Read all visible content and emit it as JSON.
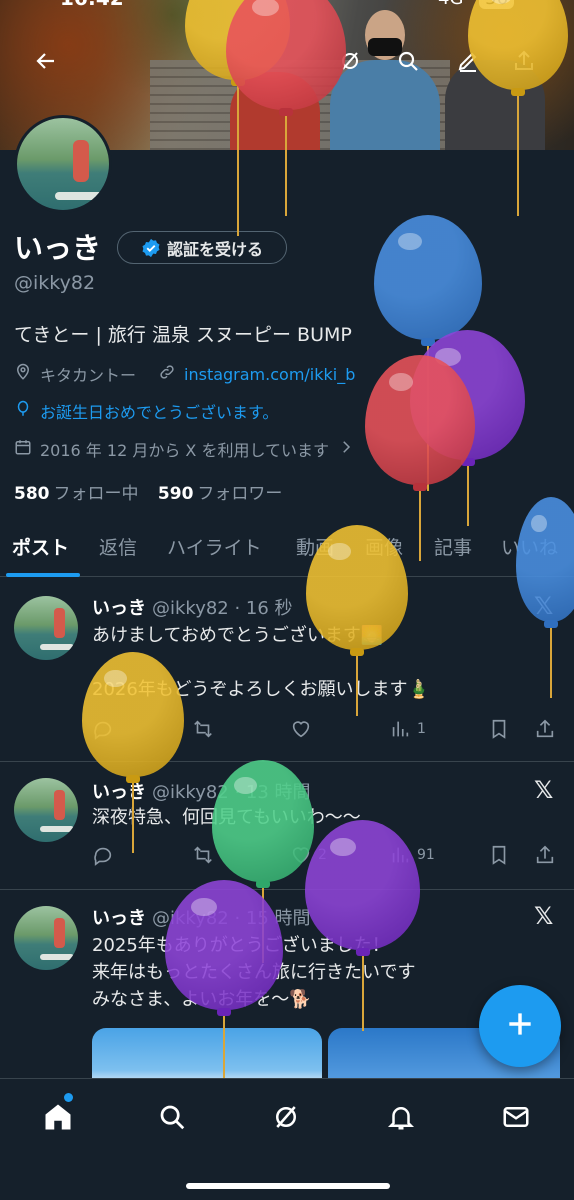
{
  "status_bar": {
    "time": "16:42",
    "signal": "4G",
    "battery": "56"
  },
  "top_bar": {
    "icons": [
      "back-arrow-icon",
      "grok-icon",
      "search-icon",
      "compose-icon",
      "share-icon"
    ]
  },
  "profile": {
    "name": "いっき",
    "verify_button": "認証を受ける",
    "handle": "@ikky82",
    "bio": "てきとー | 旅行 温泉 スヌーピー BUMP",
    "location": "キタカントー",
    "link": "instagram.com/ikki_b",
    "birthday": "お誕生日おめでとうございます。",
    "joined": "2016 年 12 月から X を利用しています",
    "following_count": "580",
    "following_label": "フォロー中",
    "followers_count": "590",
    "followers_label": "フォロワー"
  },
  "tabs": [
    "ポスト",
    "返信",
    "ハイライト",
    "動画",
    "画像",
    "記事",
    "いいね"
  ],
  "posts": [
    {
      "name": "いっき",
      "meta": "@ikky82 · 16 秒",
      "text": "あけましておめでとうございます🌅\n\n2026年もどうぞよろしくお願いします🎍",
      "retweets": "",
      "likes": "",
      "views": "1"
    },
    {
      "name": "いっき",
      "meta": "@ikky82 · 13 時間",
      "text": "深夜特急、何回見てもいいわ〜〜",
      "retweets": "",
      "likes": "2",
      "views": "91"
    },
    {
      "name": "いっき",
      "meta": "@ikky82 · 15 時間",
      "text": "2025年もありがとうございました！\n来年はもっとたくさん旅に行きたいです\nみなさま、よいお年を〜🐕",
      "retweets": "",
      "likes": "",
      "views": ""
    }
  ],
  "fab": {
    "icon": "plus-icon"
  },
  "bottom_nav": [
    "home-icon",
    "search-icon",
    "grok-icon",
    "notifications-icon",
    "messages-icon"
  ],
  "colors": {
    "background": "#15202b",
    "accent": "#1d9bf0",
    "secondary_text": "#8b98a5",
    "divider": "#38444d"
  },
  "overlay": {
    "balloons": [
      "yellow",
      "red",
      "yellow",
      "blue",
      "purple",
      "red",
      "yellow",
      "blue",
      "yellow",
      "green",
      "purple",
      "purple"
    ]
  }
}
